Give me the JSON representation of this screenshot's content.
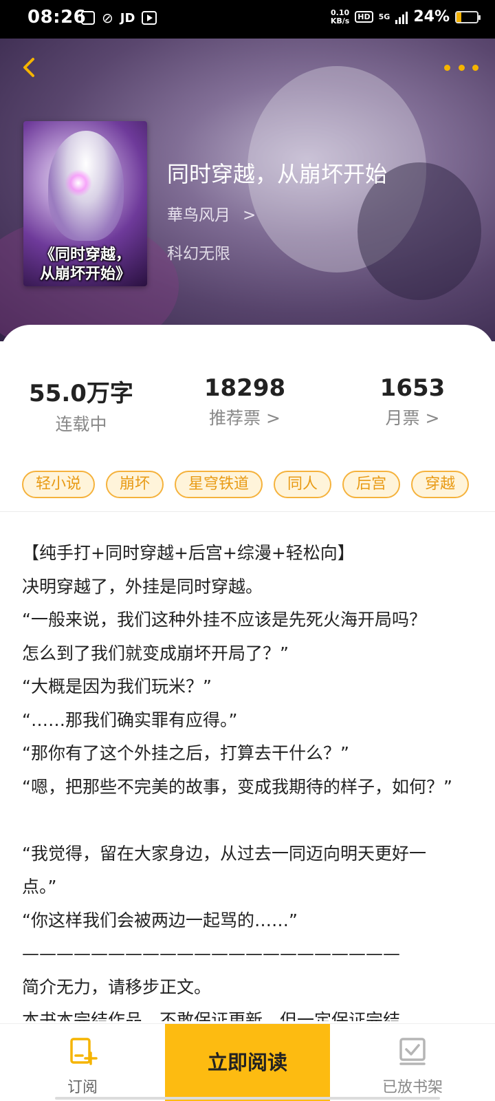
{
  "status_bar": {
    "time": "08:26",
    "jd_label": "JD",
    "net_speed_value": "0.10",
    "net_speed_unit": "KB/s",
    "hd_label": "HD",
    "network_label": "5G",
    "battery_percent": "24%",
    "battery_level": 0.24
  },
  "header": {
    "back_icon": "chevron-left-icon",
    "more_icon": "more-dots-icon",
    "accent_color": "#f5b400"
  },
  "book": {
    "cover_title_line1": "《同时穿越，",
    "cover_title_line2": "从崩坏开始》",
    "title": "同时穿越，从崩坏开始",
    "author": "華鸟风月",
    "author_chevron": ">",
    "genre": "科幻无限"
  },
  "stats": {
    "words_value": "55.0万字",
    "words_label": "连载中",
    "recommend_value": "18298",
    "recommend_label": "推荐票 >",
    "monthly_value": "1653",
    "monthly_label": "月票 >"
  },
  "tags": [
    "轻小说",
    "崩坏",
    "星穹铁道",
    "同人",
    "后宫",
    "穿越"
  ],
  "synopsis": [
    "【纯手打+同时穿越+后宫+综漫+轻松向】",
    "决明穿越了，外挂是同时穿越。",
    "“一般来说，我们这种外挂不应该是先死火海开局吗？",
    "怎么到了我们就变成崩坏开局了？”",
    "“大概是因为我们玩米？”",
    "“……那我们确实罪有应得。”",
    "“那你有了这个外挂之后，打算去干什么？”",
    "“嗯，把那些不完美的故事，变成我期待的样子，如何？”",
    "",
    "“我觉得，留在大家身边，从过去一同迈向明天更好一",
    "点。”",
    "“你这样我们会被两边一起骂的……”",
    "——————————————————————",
    "简介无力，请移步正文。",
    "本书本完结作品，不敢保证更新，但一定保证完结"
  ],
  "bottom_bar": {
    "subscribe_label": "订阅",
    "subscribe_icon": "subscribe-plus-icon",
    "read_label": "立即阅读",
    "shelf_label": "已放书架",
    "shelf_icon": "bookshelf-check-icon",
    "read_color": "#fdbb11"
  }
}
